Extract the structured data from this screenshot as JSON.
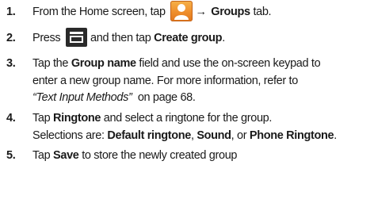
{
  "steps": [
    {
      "number": "1.",
      "text_before": "From the Home screen, tap",
      "icon": "contacts-icon",
      "arrow": "→",
      "bold_1": "Groups",
      "text_after": "tab."
    },
    {
      "number": "2.",
      "text_before": "Press",
      "icon": "menu-icon",
      "text_middle": "and then tap",
      "bold_1": "Create group",
      "text_after": "."
    },
    {
      "number": "3.",
      "text_1": "Tap the",
      "bold_1": "Group name",
      "text_2": "field and use the on-screen keypad to",
      "line_2": "enter a new group name. For more information, refer to",
      "italic_ref": "“Text Input Methods”",
      "text_3": "on page 68."
    },
    {
      "number": "4.",
      "text_1": "Tap",
      "bold_1": "Ringtone",
      "text_2": "and select a ringtone for the group.",
      "line_2_prefix": "Selections are:",
      "bold_2": "Default ringtone",
      "sep_1": ",",
      "bold_3": "Sound",
      "sep_2": ", or",
      "bold_4": "Phone Ringtone",
      "end": "."
    },
    {
      "number": "5.",
      "text_1": "Tap",
      "bold_1": "Save",
      "text_2": "to store the newly created group"
    }
  ]
}
